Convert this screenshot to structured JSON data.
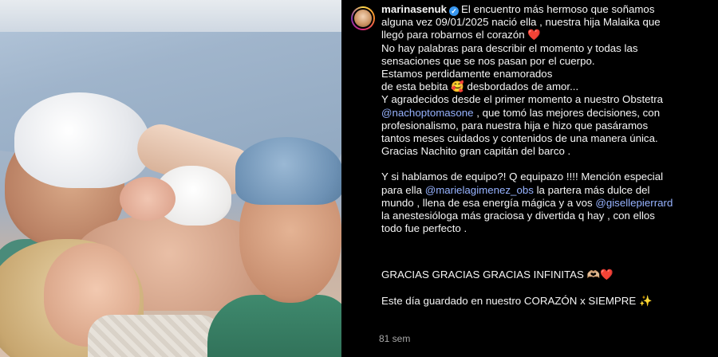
{
  "post": {
    "username": "marinasenuk",
    "verified_icon": "verified-badge-icon",
    "avatar_icon": "profile-avatar",
    "caption_lines": {
      "l1": "El encuentro más hermoso que soñamos",
      "l2": "alguna vez 09/01/2025 nació ella , nuestra hija Malaika que",
      "l3": "llegó para robarnos el corazón ❤️",
      "l4": "No hay palabras para describir el momento y todas las",
      "l5": "sensaciones que se nos pasan por el cuerpo.",
      "l6": "Estamos perdidamente enamorados",
      "l7": "de esta bebita 🥰 desbordados de amor...",
      "l8": "Y agradecidos desde el primer momento a nuestro Obstetra",
      "l9_mention": "@nachoptomasone",
      "l9_rest": " , que tomó las mejores decisiones, con",
      "l10": "profesionalismo, para nuestra hija e hizo que pasáramos",
      "l11": "tantos meses cuidados y contenidos de una manera única.",
      "l12": "Gracias Nachito gran capitán del barco .",
      "l13": "Y si hablamos de equipo?! Q equipazo !!!! Mención especial",
      "l14_pre": "para ella ",
      "l14_mention": "@marielagimenez_obs",
      "l14_rest": " la partera más dulce del",
      "l15_pre": "mundo , llena de esa energía mágica y a vos ",
      "l15_mention": "@gisellepierrard",
      "l16": "la anestesióloga más graciosa y divertida q hay , con ellos",
      "l17": "todo fue perfecto .",
      "l18": "GRACIAS GRACIAS GRACIAS INFINITAS 🫶🏼❤️",
      "l19": "Este día guardado en nuestro CORAZÓN x SIEMPRE ✨"
    },
    "timestamp": "81 sem"
  },
  "colors": {
    "background": "#000000",
    "text": "#f5f5f5",
    "mention": "#97b3ff",
    "verified": "#3897f0",
    "timestamp": "#a8a8a8"
  }
}
